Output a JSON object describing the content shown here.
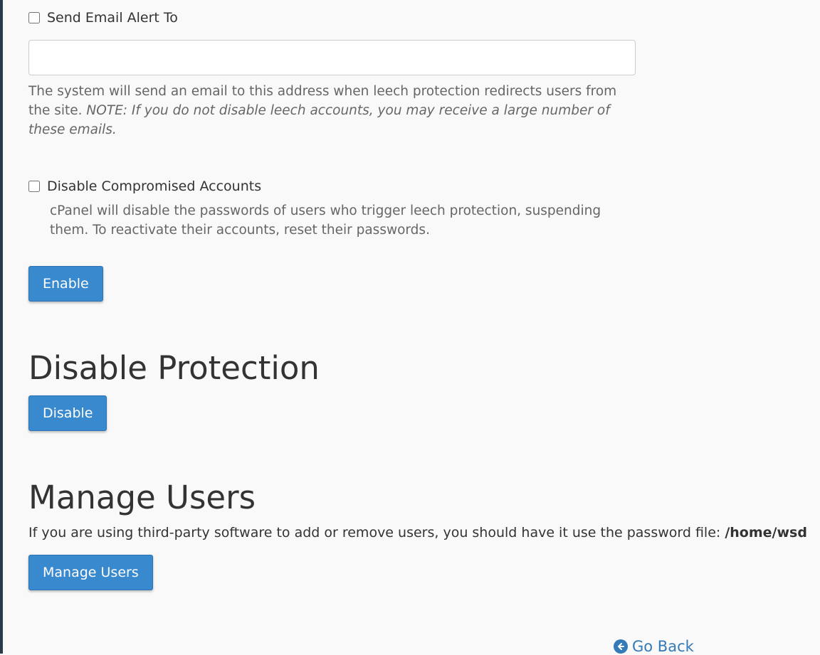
{
  "email_alert": {
    "checkbox_label": "Send Email Alert To",
    "input_value": "",
    "input_placeholder": "",
    "help_text": "The system will send an email to this address when leech protection redirects users from the site. ",
    "help_note": "NOTE: If you do not disable leech accounts, you may receive a large number of these emails."
  },
  "disable_accounts": {
    "checkbox_label": "Disable Compromised Accounts",
    "help_text": "cPanel will disable the passwords of users who trigger leech protection, suspending them. To reactivate their accounts, reset their passwords."
  },
  "enable_button": "Enable",
  "disable_section": {
    "title": "Disable Protection",
    "button": "Disable"
  },
  "manage_section": {
    "title": "Manage Users",
    "description": "If you are using third-party software to add or remove users, you should have it use the password file: ",
    "password_file": "/home/wsd",
    "button": "Manage Users"
  },
  "go_back": {
    "label": "Go Back",
    "icon": "circle-arrow-left-icon"
  },
  "colors": {
    "primary_button": "#3989cf",
    "link": "#337ab7",
    "background": "#f9f9f9",
    "left_rail": "#293a4a"
  }
}
